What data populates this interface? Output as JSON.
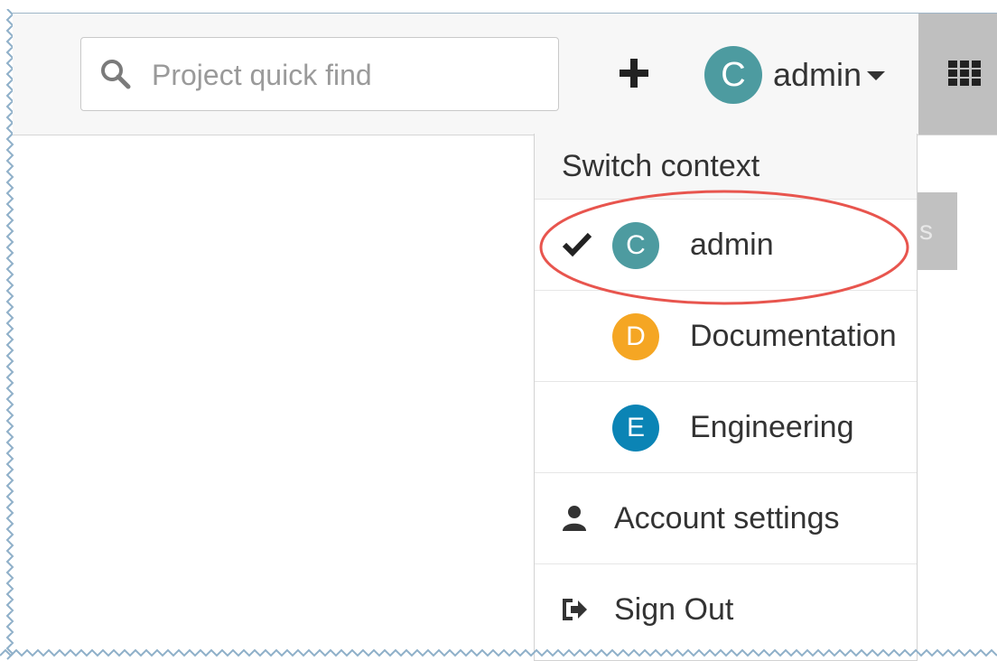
{
  "search": {
    "placeholder": "Project quick find",
    "icon": "search-icon"
  },
  "header": {
    "add_icon": "plus-icon",
    "user": {
      "initial": "C",
      "name": "admin",
      "avatar_color": "#4d9ba0"
    },
    "apps_icon": "grid-icon"
  },
  "background_tab": {
    "text": "s"
  },
  "context_menu": {
    "header": "Switch context",
    "contexts": [
      {
        "initial": "C",
        "name": "admin",
        "color": "#4d9ba0",
        "selected": true
      },
      {
        "initial": "D",
        "name": "Documentation",
        "color": "#f5a623",
        "selected": false
      },
      {
        "initial": "E",
        "name": "Engineering",
        "color": "#0b84b5",
        "selected": false
      }
    ],
    "actions": [
      {
        "label": "Account settings",
        "icon": "user-icon"
      },
      {
        "label": "Sign Out",
        "icon": "sign-out-icon"
      }
    ]
  },
  "colors": {
    "highlight": "#e8554e",
    "apps_button": "#bfbfbf"
  }
}
